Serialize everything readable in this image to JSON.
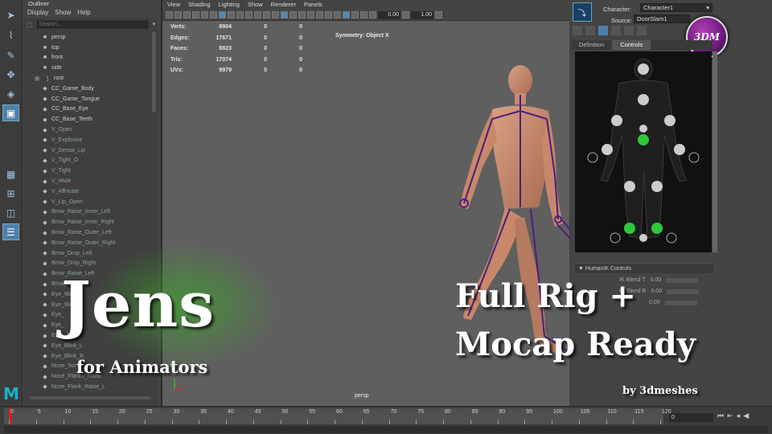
{
  "outliner": {
    "title": "Outliner",
    "menu": [
      "Display",
      "Show",
      "Help"
    ],
    "search_placeholder": "Search...",
    "items": [
      {
        "label": "persp",
        "icon": "camera-icon",
        "dim": false
      },
      {
        "label": "top",
        "icon": "camera-icon",
        "dim": false
      },
      {
        "label": "front",
        "icon": "camera-icon",
        "dim": false
      },
      {
        "label": "side",
        "icon": "camera-icon",
        "dim": false
      },
      {
        "label": "root",
        "icon": "joint-icon",
        "dim": false
      },
      {
        "label": "CC_Game_Body",
        "icon": "mesh-icon",
        "dim": false
      },
      {
        "label": "CC_Game_Tongue",
        "icon": "mesh-icon",
        "dim": false
      },
      {
        "label": "CC_Base_Eye",
        "icon": "mesh-icon",
        "dim": false
      },
      {
        "label": "CC_Base_Teeth",
        "icon": "mesh-icon",
        "dim": false
      },
      {
        "label": "V_Open",
        "icon": "mesh-icon",
        "dim": true
      },
      {
        "label": "V_Explosive",
        "icon": "mesh-icon",
        "dim": true
      },
      {
        "label": "V_Dental_Lip",
        "icon": "mesh-icon",
        "dim": true
      },
      {
        "label": "V_Tight_O",
        "icon": "mesh-icon",
        "dim": true
      },
      {
        "label": "V_Tight",
        "icon": "mesh-icon",
        "dim": true
      },
      {
        "label": "V_Wide",
        "icon": "mesh-icon",
        "dim": true
      },
      {
        "label": "V_Affricate",
        "icon": "mesh-icon",
        "dim": true
      },
      {
        "label": "V_Lip_Open",
        "icon": "mesh-icon",
        "dim": true
      },
      {
        "label": "Brow_Raise_Inner_Left",
        "icon": "mesh-icon",
        "dim": true
      },
      {
        "label": "Brow_Raise_Inner_Right",
        "icon": "mesh-icon",
        "dim": true
      },
      {
        "label": "Brow_Raise_Outer_Left",
        "icon": "mesh-icon",
        "dim": true
      },
      {
        "label": "Brow_Raise_Outer_Right",
        "icon": "mesh-icon",
        "dim": true
      },
      {
        "label": "Brow_Drop_Left",
        "icon": "mesh-icon",
        "dim": true
      },
      {
        "label": "Brow_Drop_Right",
        "icon": "mesh-icon",
        "dim": true
      },
      {
        "label": "Brow_Raise_Left",
        "icon": "mesh-icon",
        "dim": true
      },
      {
        "label": "Brow_Rai",
        "icon": "mesh-icon",
        "dim": true
      },
      {
        "label": "Eye_Wide_L",
        "icon": "mesh-icon",
        "dim": true
      },
      {
        "label": "Eye_Wide_R",
        "icon": "mesh-icon",
        "dim": true
      },
      {
        "label": "Eye_",
        "icon": "mesh-icon",
        "dim": true
      },
      {
        "label": "Eye_",
        "icon": "mesh-icon",
        "dim": true
      },
      {
        "label": "Eyes_Blink",
        "icon": "mesh-icon",
        "dim": true
      },
      {
        "label": "Eye_Blink_L",
        "icon": "mesh-icon",
        "dim": true
      },
      {
        "label": "Eye_Blink_R",
        "icon": "mesh-icon",
        "dim": true
      },
      {
        "label": "Nose_Scr",
        "icon": "mesh-icon",
        "dim": true
      },
      {
        "label": "Nose_Flanks_Raise",
        "icon": "mesh-icon",
        "dim": true
      },
      {
        "label": "Nose_Flank_Raise_L",
        "icon": "mesh-icon",
        "dim": true
      }
    ]
  },
  "viewport": {
    "menu": [
      "View",
      "Shading",
      "Lighting",
      "Show",
      "Renderer",
      "Panels"
    ],
    "field_a": "0.00",
    "field_b": "1.00",
    "hud": [
      {
        "k": "Verts:",
        "v": "8904",
        "c1": "0",
        "c2": "0"
      },
      {
        "k": "Edges:",
        "v": "17671",
        "c1": "0",
        "c2": "0"
      },
      {
        "k": "Faces:",
        "v": "8823",
        "c1": "0",
        "c2": "0"
      },
      {
        "k": "Tris:",
        "v": "17074",
        "c1": "0",
        "c2": "0"
      },
      {
        "k": "UVs:",
        "v": "9979",
        "c1": "0",
        "c2": "0"
      }
    ],
    "symmetry": "Symmetry: Object X",
    "camera_label": "persp"
  },
  "right_panel": {
    "character_label": "Character:",
    "character_value": "Character1",
    "source_label": "Source:",
    "source_value": "DoorSlam1",
    "tabs": [
      "Definition",
      "Controls"
    ],
    "active_tab": "Controls",
    "section_title": "HumanIK Controls",
    "blend_rows": [
      {
        "label": "IK Blend T",
        "value": "0.00"
      },
      {
        "label": "IK Blend R",
        "value": "0.00"
      },
      {
        "label": "",
        "value": "0.00"
      }
    ],
    "badge": "3DM"
  },
  "timeline": {
    "ticks": [
      "0",
      "5",
      "10",
      "15",
      "20",
      "25",
      "30",
      "35",
      "40",
      "45",
      "50",
      "55",
      "60",
      "65",
      "70",
      "75",
      "80",
      "85",
      "90",
      "95",
      "100",
      "105",
      "110",
      "115",
      "120"
    ],
    "current_frame": "0"
  },
  "promo": {
    "title": "Jens",
    "subtitle": "for Animators",
    "line1": "Full Rig +",
    "line2": "Mocap Ready",
    "byline": "by 3dmeshes"
  },
  "colors": {
    "accent_blue": "#4f7fa8",
    "maya_teal": "#17b3c9",
    "ik_green": "#2fc83a",
    "rig_purple": "#5a2a8a",
    "badge_purple": "#8a2a96"
  }
}
